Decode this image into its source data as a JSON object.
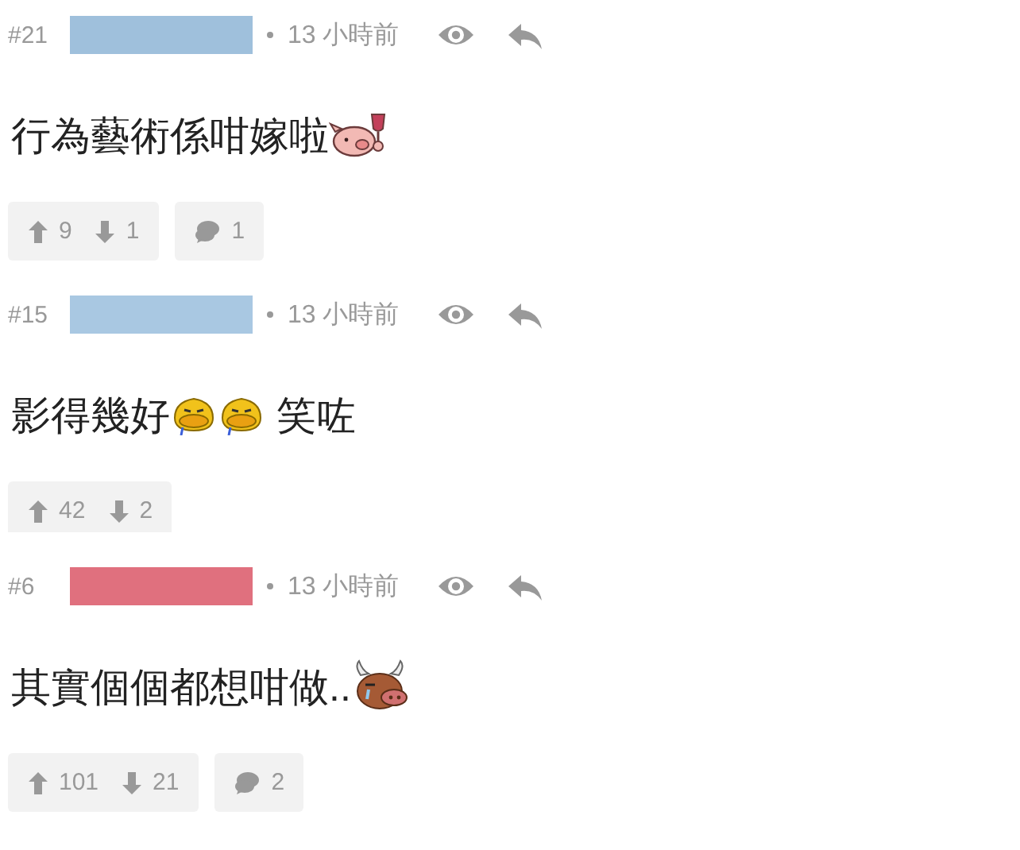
{
  "comments": [
    {
      "number": "#21",
      "mask": {
        "color": "#9fc0dc"
      },
      "time": "13 小時前",
      "body": [
        {
          "kind": "text",
          "text": "行為藝術係咁嫁啦"
        },
        {
          "kind": "pig"
        }
      ],
      "actions": {
        "up": "9",
        "down": "1",
        "replies": "1"
      },
      "cut": false
    },
    {
      "number": "#15",
      "mask": {
        "color": "#a9c8e2"
      },
      "time": "13 小時前",
      "body": [
        {
          "kind": "text",
          "text": "影得幾好"
        },
        {
          "kind": "duck"
        },
        {
          "kind": "duck"
        },
        {
          "kind": "text",
          "text": " 笑咗"
        }
      ],
      "actions": {
        "up": "42",
        "down": "2"
      },
      "cut": true
    },
    {
      "number": "#6",
      "mask": {
        "color": "#e0707e"
      },
      "time": "13 小時前",
      "body": [
        {
          "kind": "text",
          "text": "其實個個都想咁做.."
        },
        {
          "kind": "bull"
        }
      ],
      "actions": {
        "up": "101",
        "down": "21",
        "replies": "2"
      },
      "cut": false
    }
  ]
}
